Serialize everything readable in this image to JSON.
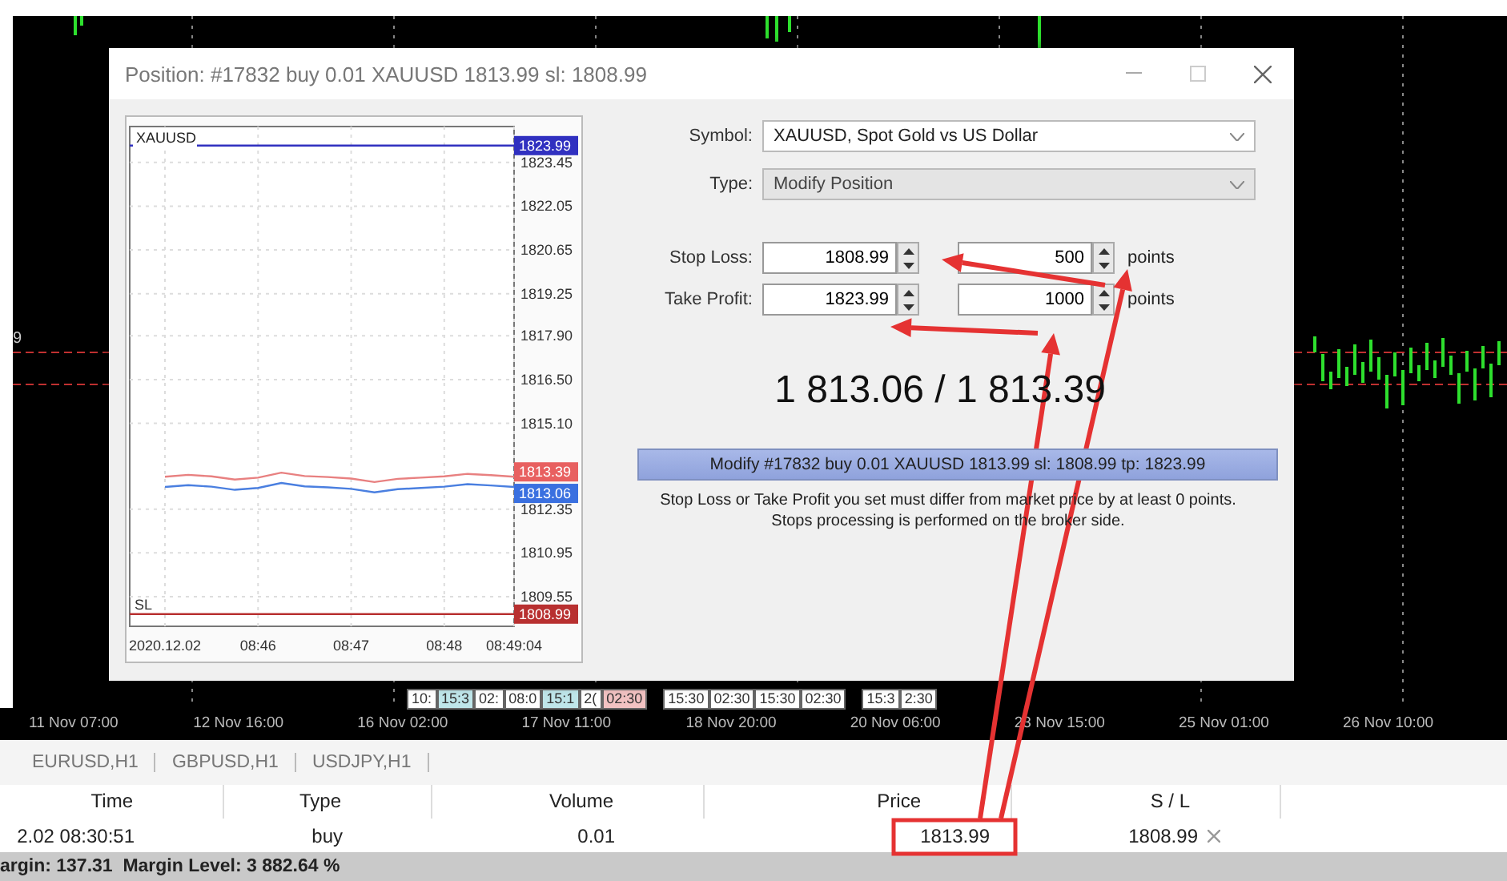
{
  "background_chart": {
    "edge_label": "9"
  },
  "dialog": {
    "title": "Position: #17832 buy 0.01 XAUUSD 1813.99 sl: 1808.99",
    "chart": {
      "chart_data": {
        "type": "line",
        "title": "XAUUSD",
        "categories": [
          "2020.12.02",
          null,
          null,
          null,
          "08:46",
          null,
          null,
          null,
          "08:47",
          null,
          null,
          null,
          "08:48",
          null,
          null,
          "08:49:04"
        ],
        "series": [
          {
            "color": "#e88080",
            "values": [
              1813.39,
              1813.45,
              1813.4,
              1813.3,
              1813.36,
              1813.52,
              1813.41,
              1813.38,
              1813.33,
              1813.22,
              1813.32,
              1813.36,
              1813.4,
              1813.48,
              1813.44,
              1813.39
            ]
          },
          {
            "color": "#4a7fe0",
            "values": [
              1813.06,
              1813.12,
              1813.07,
              1812.97,
              1813.03,
              1813.19,
              1813.08,
              1813.05,
              1813.0,
              1812.89,
              1812.99,
              1813.03,
              1813.07,
              1813.15,
              1813.11,
              1813.06
            ]
          }
        ],
        "ylim": [
          1808.6,
          1824.6
        ],
        "grid": true,
        "ref_lines": [
          {
            "axis": "y",
            "value": 1823.99,
            "color": "#3030c0"
          },
          {
            "axis": "y",
            "value": 1808.99,
            "color": "#b83030",
            "label": "SL"
          }
        ],
        "yticks": [
          {
            "value": 1823.45,
            "label": "1823.45"
          },
          {
            "value": 1822.05,
            "label": "1822.05"
          },
          {
            "value": 1820.65,
            "label": "1820.65"
          },
          {
            "value": 1819.25,
            "label": "1819.25"
          },
          {
            "value": 1817.9,
            "label": "1817.90"
          },
          {
            "value": 1816.5,
            "label": "1816.50"
          },
          {
            "value": 1815.1,
            "label": "1815.10"
          },
          {
            "value": 1812.35,
            "label": "1812.35"
          },
          {
            "value": 1810.95,
            "label": "1810.95"
          },
          {
            "value": 1809.55,
            "label": "1809.55"
          }
        ]
      },
      "price_tags": [
        {
          "text": "1823.99",
          "color": "#3030c0"
        },
        {
          "text": "1813.39",
          "color": "#e86060"
        },
        {
          "text": "1813.06",
          "color": "#3a70e0"
        },
        {
          "text": "1808.99",
          "color": "#b83030"
        }
      ]
    },
    "symbol": {
      "label": "Symbol:",
      "value": "XAUUSD, Spot Gold vs US Dollar",
      "disabled": false
    },
    "type": {
      "label": "Type:",
      "value": "Modify Position",
      "disabled": true
    },
    "stop_loss": {
      "label": "Stop Loss:",
      "price": "1808.99",
      "points": "500",
      "unit": "points"
    },
    "take_profit": {
      "label": "Take Profit:",
      "price": "1823.99",
      "points": "1000",
      "unit": "points"
    },
    "quote": "1 813.06 / 1 813.39",
    "button": "Modify #17832 buy 0.01 XAUUSD 1813.99 sl: 1808.99 tp: 1823.99",
    "note": [
      "Stop Loss or Take Profit you set must differ from market price by at least 0 points.",
      "Stops processing is performed on the broker side."
    ]
  },
  "session_tags": [
    {
      "text": "10:",
      "color": "#ffffff"
    },
    {
      "text": "15:3",
      "color": "#bfe6ea"
    },
    {
      "text": "02:",
      "color": "#ffffff"
    },
    {
      "text": "08:0",
      "color": "#ffffff"
    },
    {
      "text": "15:1",
      "color": "#bfe6ea"
    },
    {
      "text": "2(",
      "color": "#ffffff"
    },
    {
      "text": "02:30",
      "color": "#f2c2c2"
    },
    {
      "text": "15:30",
      "color": "#ffffff"
    },
    {
      "text": "02:30",
      "color": "#ffffff"
    },
    {
      "text": "15:30",
      "color": "#ffffff"
    },
    {
      "text": "02:30",
      "color": "#ffffff"
    },
    {
      "text": "15:3",
      "color": "#ffffff"
    },
    {
      "text": "2:30",
      "color": "#ffffff"
    }
  ],
  "time_axis": [
    "11 Nov 07:00",
    "12 Nov 16:00",
    "16 Nov 02:00",
    "17 Nov 11:00",
    "18 Nov 20:00",
    "20 Nov 06:00",
    "23 Nov 15:00",
    "25 Nov 01:00",
    "26 Nov 10:00"
  ],
  "chart_tabs": [
    {
      "label": "EURUSD,H1",
      "selected": false
    },
    {
      "label": "GBPUSD,H1",
      "selected": false
    },
    {
      "label": "USDJPY,H1",
      "selected": false
    }
  ],
  "table": {
    "columns": [
      "Time",
      "Type",
      "Volume",
      "Price",
      "S / L"
    ],
    "rows": [
      {
        "cells": [
          "2.02 08:30:51",
          "buy",
          "0.01",
          "1813.99",
          "1808.99"
        ]
      }
    ]
  },
  "status_bar": "argin: 137.31  Margin Level: 3 882.64 %"
}
